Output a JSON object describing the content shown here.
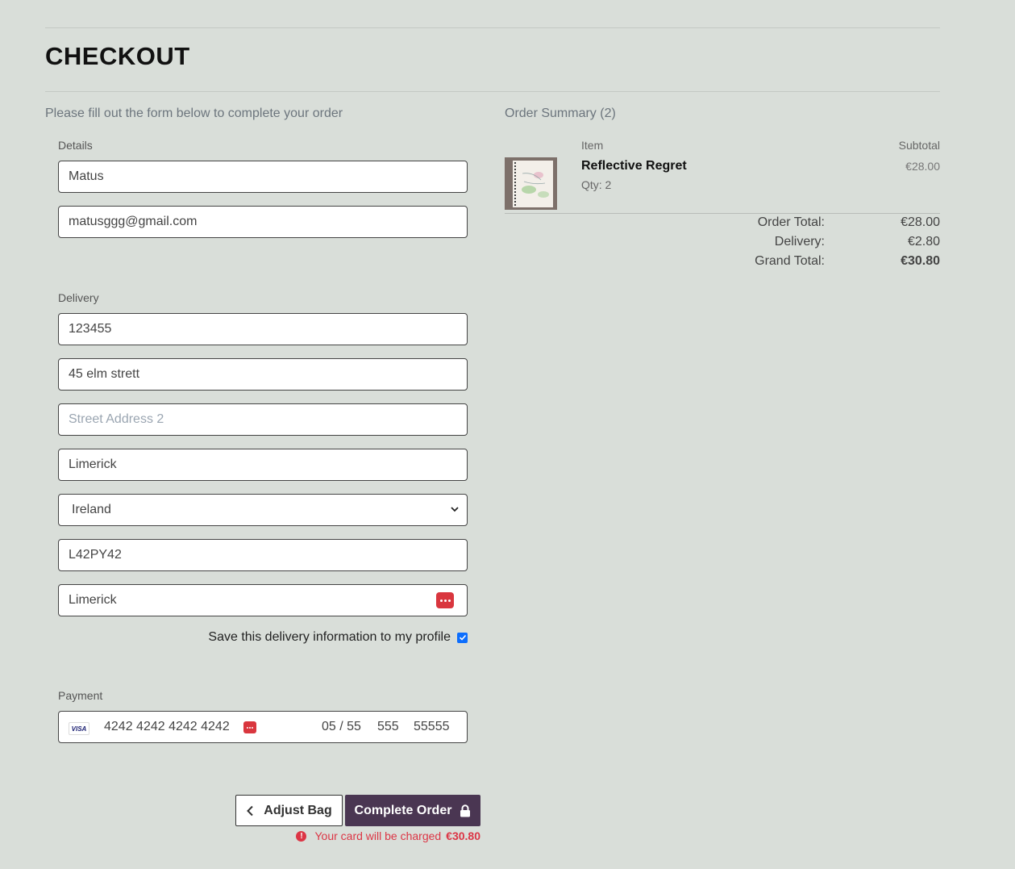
{
  "page": {
    "title": "CHECKOUT",
    "intro": "Please fill out the form below to complete your order"
  },
  "details": {
    "legend": "Details",
    "full_name": "Matus",
    "email": "matusggg@gmail.com"
  },
  "delivery": {
    "legend": "Delivery",
    "phone": "123455",
    "street1": "45 elm strett",
    "street2_placeholder": "Street Address 2",
    "town": "Limerick",
    "country": "Ireland",
    "postcode": "L42PY42",
    "county": "Limerick",
    "save_label": "Save this delivery information to my profile",
    "save_checked": true
  },
  "payment": {
    "legend": "Payment",
    "brand": "VISA",
    "card_number": "4242 4242 4242 4242",
    "expiry": "05 / 55",
    "cvc": "555",
    "zip": "55555"
  },
  "actions": {
    "adjust_label": "Adjust Bag",
    "complete_label": "Complete Order",
    "charge_text": "Your card will be charged",
    "charge_amount": "€30.80"
  },
  "summary": {
    "title": "Order Summary (2)",
    "col_item": "Item",
    "col_subtotal": "Subtotal",
    "items": [
      {
        "name": "Reflective Regret",
        "qty": "Qty: 2",
        "subtotal": "€28.00"
      }
    ],
    "order_total_label": "Order Total:",
    "order_total": "€28.00",
    "delivery_label": "Delivery:",
    "delivery": "€2.80",
    "grand_total_label": "Grand Total:",
    "grand_total": "€30.80"
  },
  "colors": {
    "background": "#d9ded9",
    "primary_button": "#4a3652",
    "error": "#dc3545",
    "checkbox": "#0d6efd"
  },
  "icons": [
    "chevron-left-icon",
    "lock-icon",
    "chevron-down-icon",
    "password-manager-icon",
    "warning-circle-icon",
    "visa-icon"
  ]
}
